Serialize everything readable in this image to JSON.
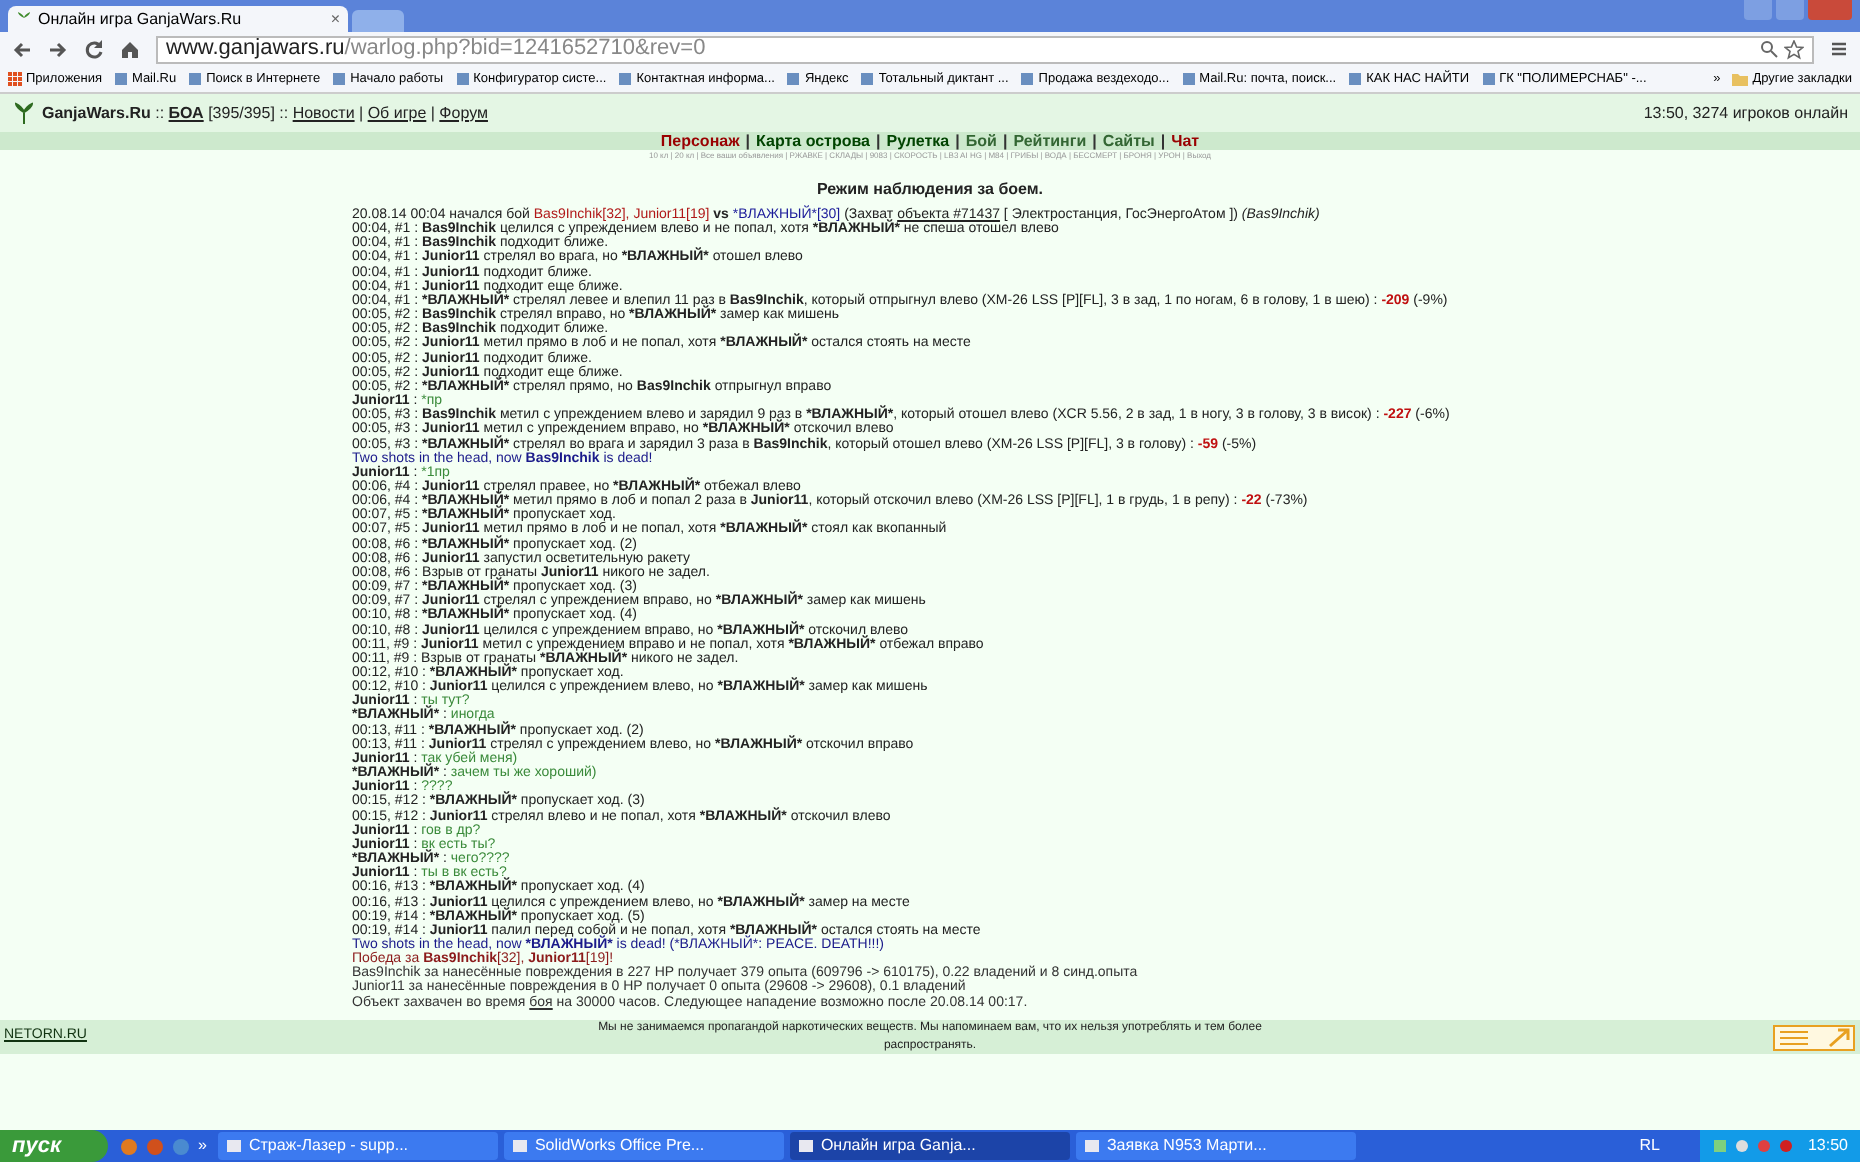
{
  "browser": {
    "tabs": [
      {
        "title": "Онлайн игра GanjaWars.Ru",
        "close": "×",
        "selected": true
      }
    ],
    "address": {
      "host": "www.ganjawars.ru",
      "path": "/warlog.php?bid=1241652710&rev=0"
    },
    "bookmarks": [
      {
        "kind": "apps",
        "label": "Приложения"
      },
      {
        "kind": "page",
        "label": "Mail.Ru"
      },
      {
        "kind": "page",
        "label": "Поиск в Интернете"
      },
      {
        "kind": "page",
        "label": "Начало работы"
      },
      {
        "kind": "page",
        "label": "Конфигуратор систе..."
      },
      {
        "kind": "page",
        "label": "Контактная информа..."
      },
      {
        "kind": "page",
        "label": "Яндекс"
      },
      {
        "kind": "page",
        "label": "Тотальный диктант ..."
      },
      {
        "kind": "page",
        "label": "Продажа вездеходо..."
      },
      {
        "kind": "page",
        "label": "Mail.Ru: почта, поиск..."
      },
      {
        "kind": "page",
        "label": "КАК НАС НАЙТИ"
      },
      {
        "kind": "page",
        "label": "ГК \"ПОЛИМЕРСНАБ\" -..."
      },
      {
        "kind": "more",
        "label": "»"
      },
      {
        "kind": "folder",
        "label": "Другие закладки"
      }
    ]
  },
  "game_header": {
    "parts": [
      {
        "text": "GanjaWars.Ru",
        "kind": "bold"
      },
      {
        "text": " :: "
      },
      {
        "text": "БОА",
        "kind": "link-bold"
      },
      {
        "text": " [395/395] :: "
      },
      {
        "text": "Новости",
        "kind": "link"
      },
      {
        "text": " | "
      },
      {
        "text": "Об игре",
        "kind": "link"
      },
      {
        "text": " | "
      },
      {
        "text": "Форум",
        "kind": "link"
      }
    ],
    "online": "13:50, 3274 игроков онлайн"
  },
  "nav": {
    "separator": "|",
    "items": [
      {
        "label": "Персонаж",
        "color": "#990000"
      },
      {
        "label": "Карта острова",
        "color": "#004400"
      },
      {
        "label": "Рулетка",
        "color": "#004400"
      },
      {
        "label": "Бой",
        "color": "#336633"
      },
      {
        "label": "Рейтинги",
        "color": "#336633"
      },
      {
        "label": "Сайты",
        "color": "#336633"
      },
      {
        "label": "Чат",
        "color": "#990000"
      }
    ]
  },
  "subnav": "10 кл | 20 кл | Все ваши объявления | РЖАВКЕ | СКЛАДЫ | 9083 | СКОРОСТЬ | LB3 AI HG | M84 | ГРИБЫ | ВОДА | БЕССМЕРТ | БРОНЯ | УРОН | Выход",
  "log": {
    "title": "Режим наблюдения за боем.",
    "lines": [
      {
        "kind": "event",
        "parts": [
          {
            "text": "20.08.14 00:04 начался бой "
          },
          {
            "text": "Bas9Inchik[32], Junior11[19]",
            "kind": "red"
          },
          {
            "text": " vs ",
            "kind": "bold"
          },
          {
            "text": "*ВЛАЖНЫЙ*[30]",
            "kind": "blue"
          },
          {
            "text": " (Захват "
          },
          {
            "text": "объекта #71437",
            "kind": "link"
          },
          {
            "text": " [ Электростанция, ГосЭнергоАтом ]) "
          },
          {
            "text": "(Bas9Inchik)",
            "kind": "italic"
          }
        ]
      },
      {
        "kind": "event",
        "parts": [
          {
            "text": "00:04, #1 : "
          },
          {
            "text": "Bas9Inchik",
            "kind": "bold"
          },
          {
            "text": " целился с упреждением влево и не попал, хотя "
          },
          {
            "text": "*ВЛАЖНЫЙ*",
            "kind": "bold"
          },
          {
            "text": " не спеша отошел влево"
          }
        ]
      },
      {
        "kind": "event",
        "parts": [
          {
            "text": "00:04, #1 : "
          },
          {
            "text": "Bas9Inchik",
            "kind": "bold"
          },
          {
            "text": " подходит ближе."
          }
        ]
      },
      {
        "kind": "event",
        "parts": [
          {
            "text": "00:04, #1 : "
          },
          {
            "text": "Junior11",
            "kind": "bold"
          },
          {
            "text": " стрелял во врага, но "
          },
          {
            "text": "*ВЛАЖНЫЙ*",
            "kind": "bold"
          },
          {
            "text": " отошел влево"
          }
        ]
      },
      {
        "kind": "event",
        "parts": [
          {
            "text": "00:04, #1 : "
          },
          {
            "text": "Junior11",
            "kind": "bold"
          },
          {
            "text": " подходит ближе."
          }
        ]
      },
      {
        "kind": "event",
        "parts": [
          {
            "text": "00:04, #1 : "
          },
          {
            "text": "Junior11",
            "kind": "bold"
          },
          {
            "text": " подходит еще ближе."
          }
        ]
      },
      {
        "kind": "event",
        "parts": [
          {
            "text": "00:04, #1 : "
          },
          {
            "text": "*ВЛАЖНЫЙ*",
            "kind": "bold"
          },
          {
            "text": " стрелял левее и влепил 11 раз в "
          },
          {
            "text": "Bas9Inchik",
            "kind": "bold"
          },
          {
            "text": ", который отпрыгнул влево (ХМ-26 LSS [P][FL], 3 в зад, 1 по ногам, 6 в голову, 1 в шею) : "
          },
          {
            "text": "-209",
            "kind": "bold-red"
          },
          {
            "text": " (-9%)"
          }
        ]
      },
      {
        "kind": "event",
        "parts": [
          {
            "text": "00:05, #2 : "
          },
          {
            "text": "Bas9Inchik",
            "kind": "bold"
          },
          {
            "text": " стрелял вправо, но "
          },
          {
            "text": "*ВЛАЖНЫЙ*",
            "kind": "bold"
          },
          {
            "text": " замер как мишень"
          }
        ]
      },
      {
        "kind": "event",
        "parts": [
          {
            "text": "00:05, #2 : "
          },
          {
            "text": "Bas9Inchik",
            "kind": "bold"
          },
          {
            "text": " подходит ближе."
          }
        ]
      },
      {
        "kind": "event",
        "parts": [
          {
            "text": "00:05, #2 : "
          },
          {
            "text": "Junior11",
            "kind": "bold"
          },
          {
            "text": " метил прямо в лоб и не попал, хотя "
          },
          {
            "text": "*ВЛАЖНЫЙ*",
            "kind": "bold"
          },
          {
            "text": " остался стоять на месте"
          }
        ]
      },
      {
        "kind": "event",
        "parts": [
          {
            "text": "00:05, #2 : "
          },
          {
            "text": "Junior11",
            "kind": "bold"
          },
          {
            "text": " подходит ближе."
          }
        ]
      },
      {
        "kind": "event",
        "parts": [
          {
            "text": "00:05, #2 : "
          },
          {
            "text": "Junior11",
            "kind": "bold"
          },
          {
            "text": " подходит еще ближе."
          }
        ]
      },
      {
        "kind": "event",
        "parts": [
          {
            "text": "00:05, #2 : "
          },
          {
            "text": "*ВЛАЖНЫЙ*",
            "kind": "bold"
          },
          {
            "text": " стрелял прямо, но "
          },
          {
            "text": "Bas9Inchik",
            "kind": "bold"
          },
          {
            "text": " отпрыгнул вправо"
          }
        ]
      },
      {
        "kind": "chat",
        "parts": [
          {
            "text": "Junior11",
            "kind": "bold"
          },
          {
            "text": " : "
          },
          {
            "text": "*пр",
            "kind": "green"
          }
        ]
      },
      {
        "kind": "event",
        "parts": [
          {
            "text": "00:05, #3 : "
          },
          {
            "text": "Bas9Inchik",
            "kind": "bold"
          },
          {
            "text": " метил с упреждением влево и зарядил 9 раз в "
          },
          {
            "text": "*ВЛАЖНЫЙ*",
            "kind": "bold"
          },
          {
            "text": ", который отошел влево (XCR 5.56, 2 в зад, 1 в ногу, 3 в голову, 3 в висок) : "
          },
          {
            "text": "-227",
            "kind": "bold-red"
          },
          {
            "text": " (-6%)"
          }
        ]
      },
      {
        "kind": "event",
        "parts": [
          {
            "text": "00:05, #3 : "
          },
          {
            "text": "Junior11",
            "kind": "bold"
          },
          {
            "text": " метил с упреждением вправо, но "
          },
          {
            "text": "*ВЛАЖНЫЙ*",
            "kind": "bold"
          },
          {
            "text": " отскочил влево"
          }
        ]
      },
      {
        "kind": "event",
        "parts": [
          {
            "text": "00:05, #3 : "
          },
          {
            "text": "*ВЛАЖНЫЙ*",
            "kind": "bold"
          },
          {
            "text": " стрелял во врага и зарядил 3 раза в "
          },
          {
            "text": "Bas9Inchik",
            "kind": "bold"
          },
          {
            "text": ", который отошел влево (ХМ-26 LSS [P][FL], 3 в голову) : "
          },
          {
            "text": "-59",
            "kind": "bold-red"
          },
          {
            "text": " (-5%)"
          }
        ]
      },
      {
        "kind": "death",
        "parts": [
          {
            "text": "Two shots in the head, now "
          },
          {
            "text": "Bas9Inchik",
            "kind": "bold"
          },
          {
            "text": " is dead!"
          }
        ]
      },
      {
        "kind": "chat",
        "parts": [
          {
            "text": "Junior11",
            "kind": "bold"
          },
          {
            "text": " : "
          },
          {
            "text": "*1пр",
            "kind": "green"
          }
        ]
      },
      {
        "kind": "event",
        "parts": [
          {
            "text": "00:06, #4 : "
          },
          {
            "text": "Junior11",
            "kind": "bold"
          },
          {
            "text": " стрелял правее, но "
          },
          {
            "text": "*ВЛАЖНЫЙ*",
            "kind": "bold"
          },
          {
            "text": " отбежал влево"
          }
        ]
      },
      {
        "kind": "event",
        "parts": [
          {
            "text": "00:06, #4 : "
          },
          {
            "text": "*ВЛАЖНЫЙ*",
            "kind": "bold"
          },
          {
            "text": " метил прямо в лоб и попал 2 раза в "
          },
          {
            "text": "Junior11",
            "kind": "bold"
          },
          {
            "text": ", который отскочил влево (ХМ-26 LSS [P][FL], 1 в грудь, 1 в репу) : "
          },
          {
            "text": "-22",
            "kind": "bold-red"
          },
          {
            "text": " (-73%)"
          }
        ]
      },
      {
        "kind": "event",
        "parts": [
          {
            "text": "00:07, #5 : "
          },
          {
            "text": "*ВЛАЖНЫЙ*",
            "kind": "bold"
          },
          {
            "text": " пропускает ход."
          }
        ]
      },
      {
        "kind": "event",
        "parts": [
          {
            "text": "00:07, #5 : "
          },
          {
            "text": "Junior11",
            "kind": "bold"
          },
          {
            "text": " метил прямо в лоб и не попал, хотя "
          },
          {
            "text": "*ВЛАЖНЫЙ*",
            "kind": "bold"
          },
          {
            "text": " стоял как вкопанный"
          }
        ]
      },
      {
        "kind": "event",
        "parts": [
          {
            "text": "00:08, #6 : "
          },
          {
            "text": "*ВЛАЖНЫЙ*",
            "kind": "bold"
          },
          {
            "text": " пропускает ход. (2)"
          }
        ]
      },
      {
        "kind": "event",
        "parts": [
          {
            "text": "00:08, #6 : "
          },
          {
            "text": "Junior11",
            "kind": "bold"
          },
          {
            "text": " запустил осветительную ракету"
          }
        ]
      },
      {
        "kind": "event",
        "parts": [
          {
            "text": "00:08, #6 : Взрыв от гранаты "
          },
          {
            "text": "Junior11",
            "kind": "bold"
          },
          {
            "text": " никого не задел."
          }
        ]
      },
      {
        "kind": "event",
        "parts": [
          {
            "text": "00:09, #7 : "
          },
          {
            "text": "*ВЛАЖНЫЙ*",
            "kind": "bold"
          },
          {
            "text": " пропускает ход. (3)"
          }
        ]
      },
      {
        "kind": "event",
        "parts": [
          {
            "text": "00:09, #7 : "
          },
          {
            "text": "Junior11",
            "kind": "bold"
          },
          {
            "text": " стрелял с упреждением вправо, но "
          },
          {
            "text": "*ВЛАЖНЫЙ*",
            "kind": "bold"
          },
          {
            "text": " замер как мишень"
          }
        ]
      },
      {
        "kind": "event",
        "parts": [
          {
            "text": "00:10, #8 : "
          },
          {
            "text": "*ВЛАЖНЫЙ*",
            "kind": "bold"
          },
          {
            "text": " пропускает ход. (4)"
          }
        ]
      },
      {
        "kind": "event",
        "parts": [
          {
            "text": "00:10, #8 : "
          },
          {
            "text": "Junior11",
            "kind": "bold"
          },
          {
            "text": " целился с упреждением вправо, но "
          },
          {
            "text": "*ВЛАЖНЫЙ*",
            "kind": "bold"
          },
          {
            "text": " отскочил влево"
          }
        ]
      },
      {
        "kind": "event",
        "parts": [
          {
            "text": "00:11, #9 : "
          },
          {
            "text": "Junior11",
            "kind": "bold"
          },
          {
            "text": " метил с упреждением вправо и не попал, хотя "
          },
          {
            "text": "*ВЛАЖНЫЙ*",
            "kind": "bold"
          },
          {
            "text": " отбежал вправо"
          }
        ]
      },
      {
        "kind": "event",
        "parts": [
          {
            "text": "00:11, #9 : Взрыв от гранаты "
          },
          {
            "text": "*ВЛАЖНЫЙ*",
            "kind": "bold"
          },
          {
            "text": " никого не задел."
          }
        ]
      },
      {
        "kind": "event",
        "parts": [
          {
            "text": "00:12, #10 : "
          },
          {
            "text": "*ВЛАЖНЫЙ*",
            "kind": "bold"
          },
          {
            "text": " пропускает ход."
          }
        ]
      },
      {
        "kind": "event",
        "parts": [
          {
            "text": "00:12, #10 : "
          },
          {
            "text": "Junior11",
            "kind": "bold"
          },
          {
            "text": " целился с упреждением влево, но "
          },
          {
            "text": "*ВЛАЖНЫЙ*",
            "kind": "bold"
          },
          {
            "text": " замер как мишень"
          }
        ]
      },
      {
        "kind": "chat",
        "parts": [
          {
            "text": "Junior11",
            "kind": "bold"
          },
          {
            "text": " : "
          },
          {
            "text": "ты тут?",
            "kind": "green"
          }
        ]
      },
      {
        "kind": "chat",
        "parts": [
          {
            "text": "*ВЛАЖНЫЙ*",
            "kind": "bold"
          },
          {
            "text": " : "
          },
          {
            "text": "иногда",
            "kind": "green"
          }
        ]
      },
      {
        "kind": "event",
        "parts": [
          {
            "text": "00:13, #11 : "
          },
          {
            "text": "*ВЛАЖНЫЙ*",
            "kind": "bold"
          },
          {
            "text": " пропускает ход. (2)"
          }
        ]
      },
      {
        "kind": "event",
        "parts": [
          {
            "text": "00:13, #11 : "
          },
          {
            "text": "Junior11",
            "kind": "bold"
          },
          {
            "text": " стрелял с упреждением влево, но "
          },
          {
            "text": "*ВЛАЖНЫЙ*",
            "kind": "bold"
          },
          {
            "text": " отскочил вправо"
          }
        ]
      },
      {
        "kind": "chat",
        "parts": [
          {
            "text": "Junior11",
            "kind": "bold"
          },
          {
            "text": " : "
          },
          {
            "text": "так убей меня)",
            "kind": "green"
          }
        ]
      },
      {
        "kind": "chat",
        "parts": [
          {
            "text": "*ВЛАЖНЫЙ*",
            "kind": "bold"
          },
          {
            "text": " : "
          },
          {
            "text": "зачем ты же хороший)",
            "kind": "green"
          }
        ]
      },
      {
        "kind": "chat",
        "parts": [
          {
            "text": "Junior11",
            "kind": "bold"
          },
          {
            "text": " : "
          },
          {
            "text": "????",
            "kind": "green"
          }
        ]
      },
      {
        "kind": "event",
        "parts": [
          {
            "text": "00:15, #12 : "
          },
          {
            "text": "*ВЛАЖНЫЙ*",
            "kind": "bold"
          },
          {
            "text": " пропускает ход. (3)"
          }
        ]
      },
      {
        "kind": "event",
        "parts": [
          {
            "text": "00:15, #12 : "
          },
          {
            "text": "Junior11",
            "kind": "bold"
          },
          {
            "text": " стрелял влево и не попал, хотя "
          },
          {
            "text": "*ВЛАЖНЫЙ*",
            "kind": "bold"
          },
          {
            "text": " отскочил влево"
          }
        ]
      },
      {
        "kind": "chat",
        "parts": [
          {
            "text": "Junior11",
            "kind": "bold"
          },
          {
            "text": " : "
          },
          {
            "text": "гов в др?",
            "kind": "green"
          }
        ]
      },
      {
        "kind": "chat",
        "parts": [
          {
            "text": "Junior11",
            "kind": "bold"
          },
          {
            "text": " : "
          },
          {
            "text": "вк есть ты?",
            "kind": "green"
          }
        ]
      },
      {
        "kind": "chat",
        "parts": [
          {
            "text": "*ВЛАЖНЫЙ*",
            "kind": "bold"
          },
          {
            "text": " : "
          },
          {
            "text": "чего????",
            "kind": "green"
          }
        ]
      },
      {
        "kind": "chat",
        "parts": [
          {
            "text": "Junior11",
            "kind": "bold"
          },
          {
            "text": " : "
          },
          {
            "text": "ты в вк есть?",
            "kind": "green"
          }
        ]
      },
      {
        "kind": "event",
        "parts": [
          {
            "text": "00:16, #13 : "
          },
          {
            "text": "*ВЛАЖНЫЙ*",
            "kind": "bold"
          },
          {
            "text": " пропускает ход. (4)"
          }
        ]
      },
      {
        "kind": "event",
        "parts": [
          {
            "text": "00:16, #13 : "
          },
          {
            "text": "Junior11",
            "kind": "bold"
          },
          {
            "text": " целился с упреждением влево, но "
          },
          {
            "text": "*ВЛАЖНЫЙ*",
            "kind": "bold"
          },
          {
            "text": " замер на месте"
          }
        ]
      },
      {
        "kind": "event",
        "parts": [
          {
            "text": "00:19, #14 : "
          },
          {
            "text": "*ВЛАЖНЫЙ*",
            "kind": "bold"
          },
          {
            "text": " пропускает ход. (5)"
          }
        ]
      },
      {
        "kind": "event",
        "parts": [
          {
            "text": "00:19, #14 : "
          },
          {
            "text": "Junior11",
            "kind": "bold"
          },
          {
            "text": " палил перед собой и не попал, хотя "
          },
          {
            "text": "*ВЛАЖНЫЙ*",
            "kind": "bold"
          },
          {
            "text": " остался стоять на месте"
          }
        ]
      },
      {
        "kind": "death",
        "parts": [
          {
            "text": "Two shots in the head, now "
          },
          {
            "text": "*ВЛАЖНЫЙ*",
            "kind": "bold"
          },
          {
            "text": " is dead! (*ВЛАЖНЫЙ*: PEACE. DEATH!!!)"
          }
        ]
      },
      {
        "kind": "victory",
        "parts": [
          {
            "text": "Победа за "
          },
          {
            "text": "Bas9Inchik",
            "kind": "bold"
          },
          {
            "text": "[32], "
          },
          {
            "text": "Junior11",
            "kind": "bold"
          },
          {
            "text": "[19]!"
          }
        ]
      },
      {
        "kind": "summary",
        "parts": [
          {
            "text": "Bas9Inchik за нанесённые повреждения в 227 HP получает 379 опыта (609796 -> 610175), 0.22 владений и 8 синд.опыта"
          }
        ]
      },
      {
        "kind": "summary",
        "parts": [
          {
            "text": "Junior11 за нанесённые повреждения в 0 HP получает 0 опыта (29608 -> 29608), 0.1 владений"
          }
        ]
      },
      {
        "kind": "summary",
        "parts": [
          {
            "text": "Объект захвачен во время "
          },
          {
            "text": "боя",
            "kind": "link"
          },
          {
            "text": " на 30000 часов. Следующее нападение возможно после 20.08.14 00:17."
          }
        ]
      }
    ]
  },
  "footer": {
    "site_link": "NETORN.RU",
    "notice": "Мы не занимаемся пропагандой наркотических веществ. Мы напоминаем вам, что их нельзя употреблять и тем более распространять."
  },
  "taskbar": {
    "start": "пуск",
    "tasks": [
      {
        "label": "Страж-Лазер - supp...",
        "selected": false
      },
      {
        "label": "SolidWorks Office Pre...",
        "selected": false
      },
      {
        "label": "Онлайн игра Ganja...",
        "selected": true
      },
      {
        "label": "Заявка N953 Марти...",
        "selected": false
      }
    ],
    "more": "»",
    "language": "RL",
    "clock": "13:50"
  }
}
